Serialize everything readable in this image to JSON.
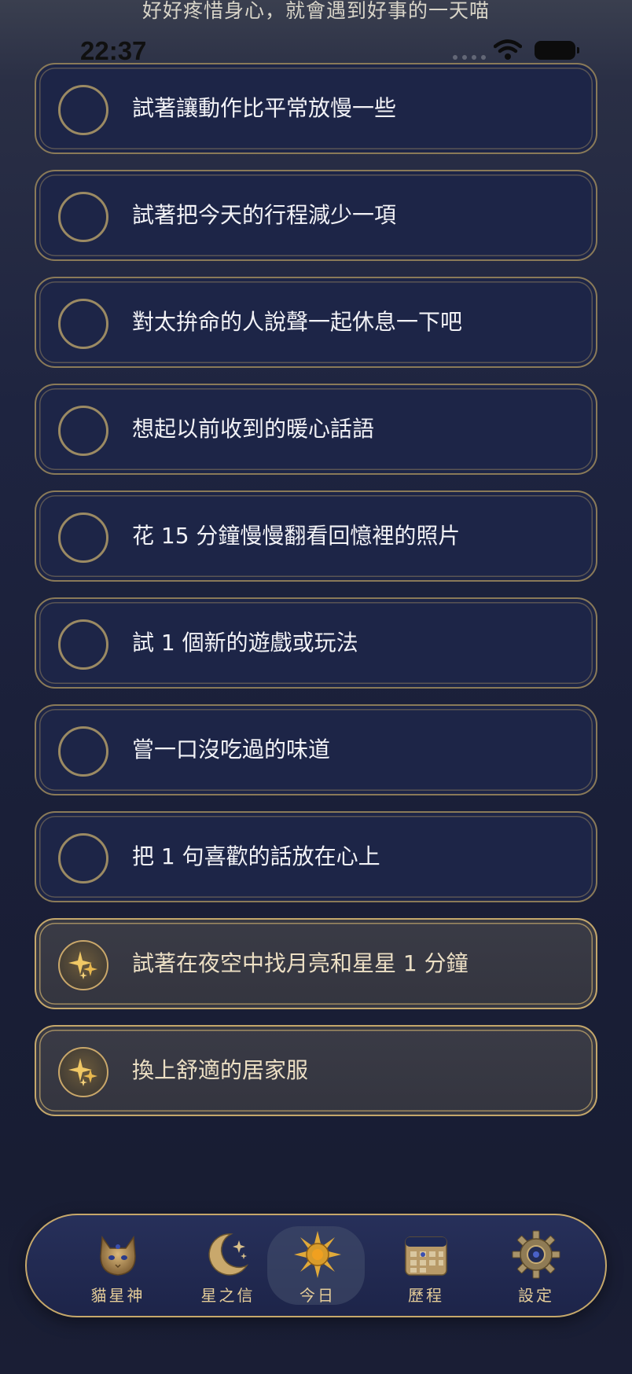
{
  "banner": "好好疼惜身心，就會遇到好事的一天喵",
  "status": {
    "time": "22:37"
  },
  "tasks": [
    {
      "label": "試著讓動作比平常放慢一些",
      "done": false
    },
    {
      "label": "試著把今天的行程減少一項",
      "done": false
    },
    {
      "label": "對太拚命的人說聲一起休息一下吧",
      "done": false
    },
    {
      "label": "想起以前收到的暖心話語",
      "done": false
    },
    {
      "label": "花 15 分鐘慢慢翻看回憶裡的照片",
      "done": false
    },
    {
      "label": "試 1 個新的遊戲或玩法",
      "done": false
    },
    {
      "label": "嘗一口沒吃過的味道",
      "done": false
    },
    {
      "label": "把 1 句喜歡的話放在心上",
      "done": false
    },
    {
      "label": "試著在夜空中找月亮和星星 1 分鐘",
      "done": true
    },
    {
      "label": "換上舒適的居家服",
      "done": true
    }
  ],
  "tabbar": {
    "active": "今日",
    "tabs": [
      {
        "label": "貓星神",
        "icon": "cat-icon"
      },
      {
        "label": "星之信",
        "icon": "moon-star-icon"
      },
      {
        "label": "今日",
        "icon": "sun-icon"
      },
      {
        "label": "歷程",
        "icon": "calendar-icon"
      },
      {
        "label": "設定",
        "icon": "gear-icon"
      }
    ]
  },
  "colors": {
    "gold": "#c6a86a",
    "card_bg": "#1d2547",
    "done_bg": "#383943"
  }
}
